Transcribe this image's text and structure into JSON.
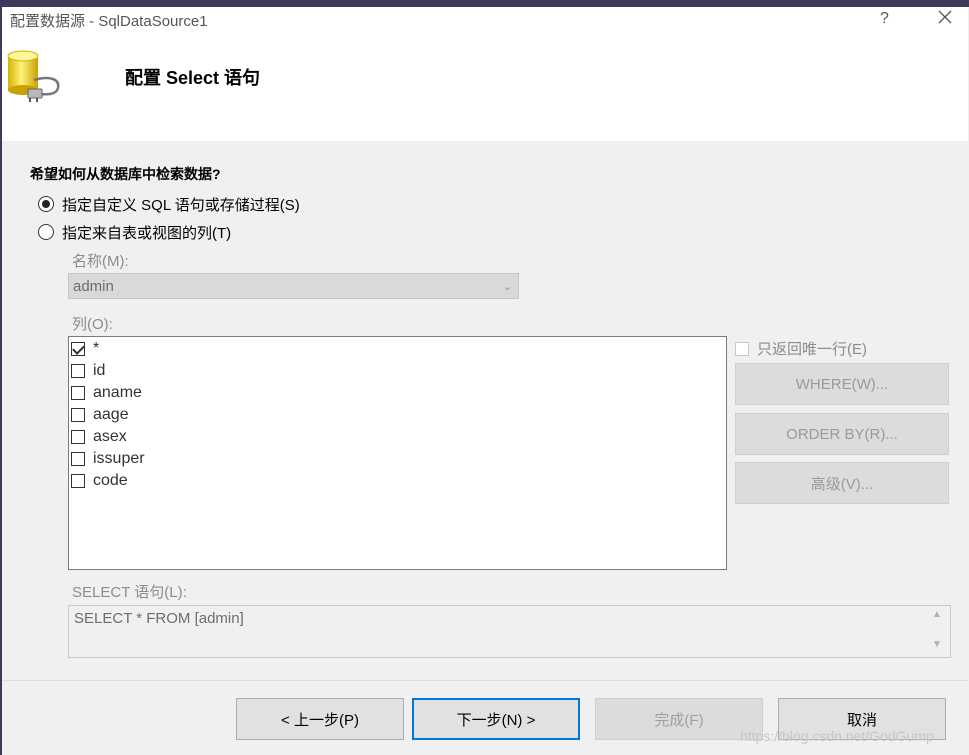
{
  "window": {
    "title": "配置数据源 - SqlDataSource1",
    "help_label": "?",
    "close_icon": "close-icon"
  },
  "header": {
    "heading": "配置 Select 语句",
    "icon": "database-icon"
  },
  "question": "希望如何从数据库中检索数据?",
  "options": {
    "custom_sql": {
      "label": "指定自定义 SQL 语句或存储过程(S)",
      "selected": true
    },
    "from_table": {
      "label": "指定来自表或视图的列(T)",
      "selected": false
    }
  },
  "name_field": {
    "label": "名称(M):",
    "value": "admin"
  },
  "columns": {
    "label": "列(O):",
    "items": [
      {
        "label": "*",
        "checked": true
      },
      {
        "label": "id",
        "checked": false
      },
      {
        "label": "aname",
        "checked": false
      },
      {
        "label": "aage",
        "checked": false
      },
      {
        "label": "asex",
        "checked": false
      },
      {
        "label": "issuper",
        "checked": false
      },
      {
        "label": "code",
        "checked": false
      }
    ]
  },
  "side": {
    "unique_label": "只返回唯一行(E)",
    "where_label": "WHERE(W)...",
    "orderby_label": "ORDER BY(R)...",
    "advanced_label": "高级(V)..."
  },
  "sql": {
    "label": "SELECT 语句(L):",
    "value": "SELECT * FROM [admin]"
  },
  "footer": {
    "prev_label": "< 上一步(P)",
    "next_label": "下一步(N) >",
    "finish_label": "完成(F)",
    "cancel_label": "取消"
  },
  "watermark": "https://blog.csdn.net/GodGump",
  "colors": {
    "accent": "#0078d7",
    "disabled_text": "#9a9a9a"
  }
}
